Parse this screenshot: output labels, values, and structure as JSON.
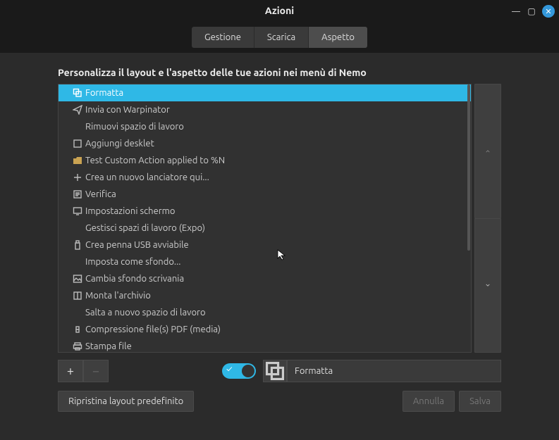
{
  "window": {
    "title": "Azioni"
  },
  "tabs": {
    "t0": "Gestione",
    "t1": "Scarica",
    "t2": "Aspetto"
  },
  "caption": "Personalizza il layout e l'aspetto delle tue azioni nei menù di Nemo",
  "actions": [
    {
      "label": "Formatta",
      "icon": "format",
      "selected": true
    },
    {
      "label": "Invia con Warpinator",
      "icon": "send"
    },
    {
      "label": "Rimuovi spazio di lavoro",
      "icon": ""
    },
    {
      "label": "Aggiungi desklet",
      "icon": "desklet"
    },
    {
      "label": "Test Custom Action applied to %N",
      "icon": "folder"
    },
    {
      "label": "Crea un nuovo lanciatore qui...",
      "icon": "plus"
    },
    {
      "label": "Verifica",
      "icon": "verify"
    },
    {
      "label": "Impostazioni schermo",
      "icon": "screen"
    },
    {
      "label": "Gestisci spazi di lavoro (Expo)",
      "icon": ""
    },
    {
      "label": "Crea penna USB avviabile",
      "icon": "usb"
    },
    {
      "label": "Imposta come sfondo...",
      "icon": ""
    },
    {
      "label": "Cambia sfondo scrivania",
      "icon": "wallpaper"
    },
    {
      "label": "Monta l'archivio",
      "icon": "archive"
    },
    {
      "label": "Salta a nuovo spazio di lavoro",
      "icon": ""
    },
    {
      "label": "Compressione file(s) PDF (media)",
      "icon": "diamond"
    },
    {
      "label": "Stampa file",
      "icon": "print"
    }
  ],
  "editRow": {
    "name_value": "Formatta"
  },
  "footer": {
    "reset": "Ripristina layout predefinito",
    "cancel": "Annulla",
    "save": "Salva"
  }
}
